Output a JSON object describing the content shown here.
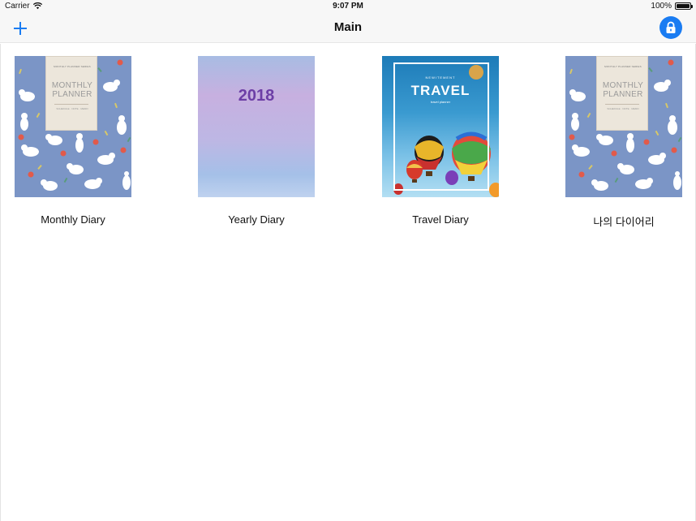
{
  "status_bar": {
    "carrier": "Carrier",
    "time": "9:07 PM",
    "battery": "100%",
    "wifi_icon": "wifi-icon",
    "battery_icon": "battery-icon"
  },
  "nav": {
    "title": "Main",
    "add_icon": "plus-icon",
    "lock_icon": "lock-icon",
    "accent": "#1a7cf2"
  },
  "diaries": [
    {
      "title": "Monthly Diary",
      "cover": {
        "top_text": "MONTHLY PLANNER SERIES",
        "headline": "MONTHLY PLANNER",
        "bottom_text": "SCHEDULE · NOTE · MEMO",
        "color": "#7b95c6"
      }
    },
    {
      "title": "Yearly Diary",
      "cover": {
        "headline": "2018",
        "color": "#6c3ea6"
      }
    },
    {
      "title": "Travel Diary",
      "cover": {
        "top_text": "NEWITEMENT",
        "headline": "TRAVEL",
        "bottom_text": "travel planner",
        "color": "#3a9ad0"
      }
    },
    {
      "title": "나의 다이어리",
      "cover": {
        "top_text": "MONTHLY PLANNER SERIES",
        "headline": "MONTHLY PLANNER",
        "bottom_text": "SCHEDULE · NOTE · MEMO",
        "color": "#7b95c6"
      }
    }
  ]
}
